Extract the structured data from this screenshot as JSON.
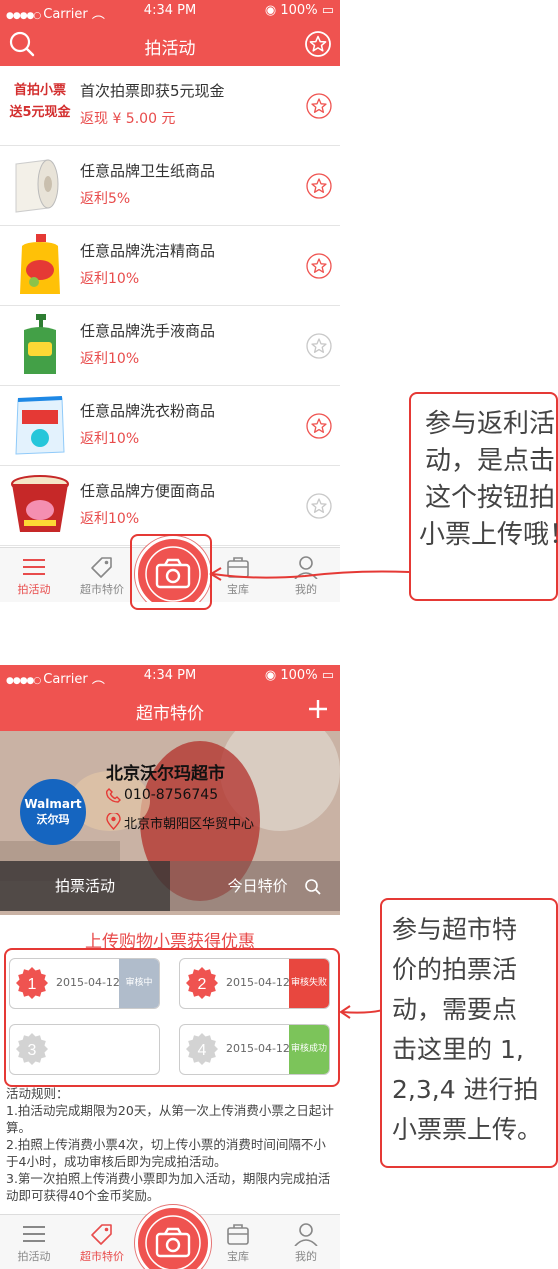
{
  "status_bar": {
    "carrier": "Carrier",
    "time": "4:34 PM",
    "battery": "100%"
  },
  "screen1": {
    "title": "拍活动",
    "items": [
      {
        "thumb_text_line1": "首拍小票",
        "thumb_text_line2": "送5元现金",
        "name": "首次拍票即获5元现金",
        "rebate": "返现 ¥ 5.00 元",
        "starred": true,
        "icon": "receipt-promo-icon"
      },
      {
        "name": "任意品牌卫生纸商品",
        "rebate": "返利5%",
        "starred": true,
        "icon": "toilet-paper-icon"
      },
      {
        "name": "任意品牌洗洁精商品",
        "rebate": "返利10%",
        "starred": true,
        "icon": "dish-soap-bottle-icon"
      },
      {
        "name": "任意品牌洗手液商品",
        "rebate": "返利10%",
        "starred": false,
        "icon": "hand-soap-bottle-icon"
      },
      {
        "name": "任意品牌洗衣粉商品",
        "rebate": "返利10%",
        "starred": true,
        "icon": "detergent-bag-icon"
      },
      {
        "name": "任意品牌方便面商品",
        "rebate": "返利10%",
        "starred": false,
        "icon": "instant-noodle-cup-icon"
      }
    ],
    "tabs": [
      "拍活动",
      "超市特价",
      "宝库",
      "我的"
    ],
    "active_tab": "拍活动"
  },
  "callout1": {
    "lines": [
      "参与返利活",
      "动，是点击",
      "这个按钮拍",
      "小票上传哦！"
    ]
  },
  "screen2": {
    "title": "超市特价",
    "logo_brand": "Walmart",
    "logo_cn": "沃尔玛",
    "store_name": "北京沃尔玛超市",
    "store_phone": "010-8756745",
    "store_address": "北京市朝阳区华贸中心",
    "banner_tab_left": "拍票活动",
    "banner_tab_right": "今日特价",
    "upload_title": "上传购物小票获得优惠",
    "slots": [
      {
        "num": "1",
        "date": "2015-04-12",
        "status": "审核中",
        "status_color": "#b0bccb",
        "active": true
      },
      {
        "num": "2",
        "date": "2015-04-12",
        "status": "审核失败",
        "status_color": "#e8473f",
        "active": true
      },
      {
        "num": "3",
        "date": "",
        "status": "",
        "status_color": "",
        "active": false
      },
      {
        "num": "4",
        "date": "2015-04-12",
        "status": "审核成功",
        "status_color": "#7cc45a",
        "active": false
      }
    ],
    "rules": [
      "活动规则：",
      "1.拍活动完成期限为20天，从第一次上传消费小票之日起计算。",
      "2.拍照上传消费小票4次，切上传小票的消费时间间隔不小于4小时，成功审核后即为完成拍活动。",
      "3.第一次拍照上传消费小票即为加入活动，期限内完成拍活动即可获得40个金币奖励。"
    ],
    "tabs": [
      "拍活动",
      "超市特价",
      "宝库",
      "我的"
    ],
    "active_tab": "超市特价"
  },
  "callout2": {
    "lines": [
      "参与超市特",
      "价的拍票活",
      "动，需要点",
      "击这里的 1,",
      "2,3,4 进行拍",
      "小票票上传。"
    ]
  },
  "colors": {
    "brand_red": "#ef5350",
    "rebate_red": "#e84c4c",
    "callout_border": "#e53935"
  }
}
